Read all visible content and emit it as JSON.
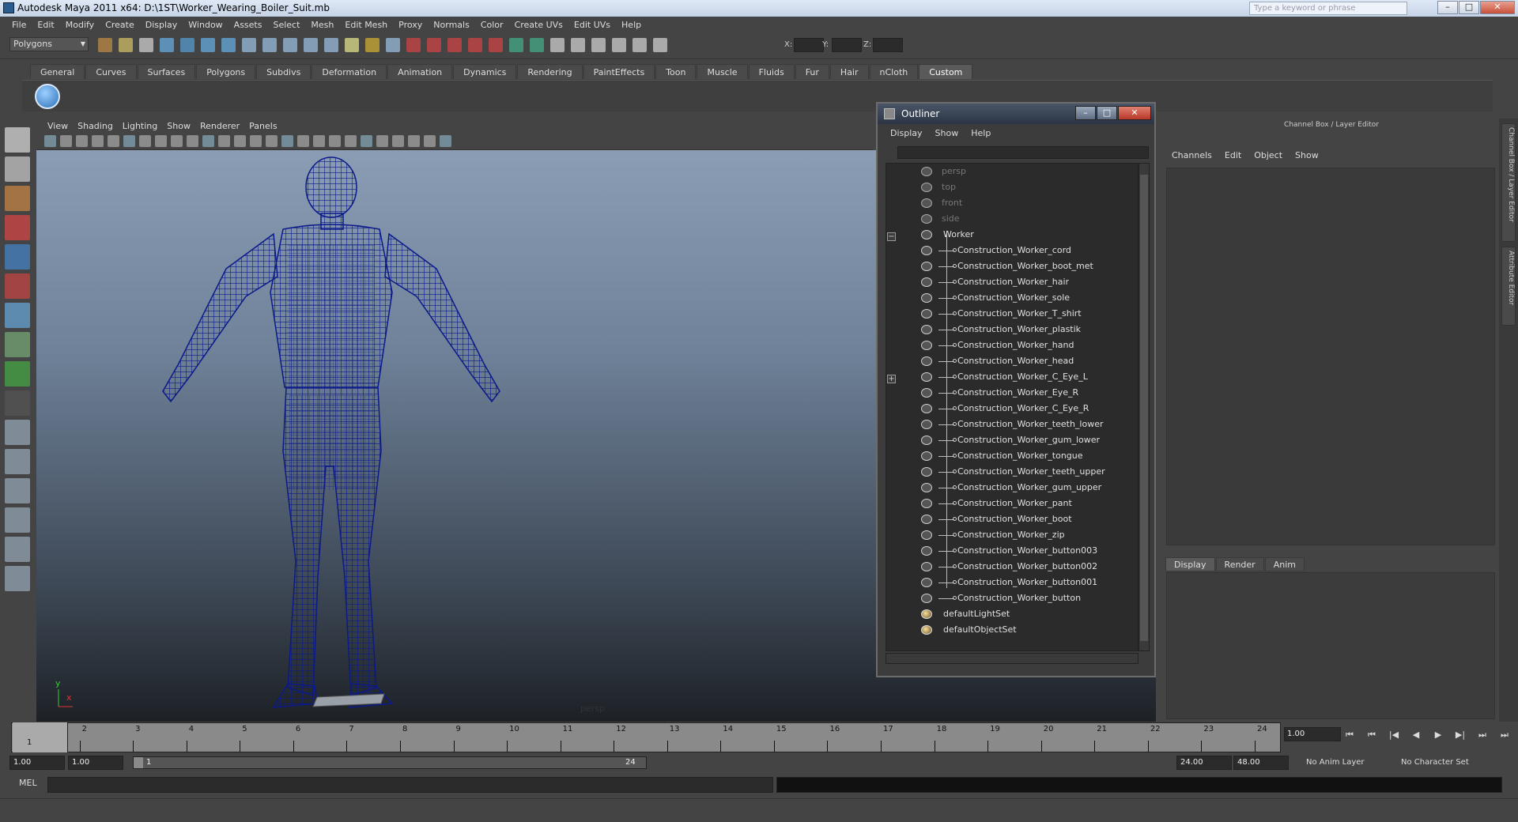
{
  "window": {
    "title": "Autodesk Maya 2011 x64: D:\\1ST\\Worker_Wearing_Boiler_Suit.mb",
    "search_placeholder": "Type a keyword or phrase",
    "min": "–",
    "max": "□",
    "close": "✕"
  },
  "menubar": [
    "File",
    "Edit",
    "Modify",
    "Create",
    "Display",
    "Window",
    "Assets",
    "Select",
    "Mesh",
    "Edit Mesh",
    "Proxy",
    "Normals",
    "Color",
    "Create UVs",
    "Edit UVs",
    "Help"
  ],
  "toolbar": {
    "mode": "Polygons",
    "x_label": "X:",
    "y_label": "Y:",
    "z_label": "Z:"
  },
  "shelf": {
    "tabs": [
      "General",
      "Curves",
      "Surfaces",
      "Polygons",
      "Subdivs",
      "Deformation",
      "Animation",
      "Dynamics",
      "Rendering",
      "PaintEffects",
      "Toon",
      "Muscle",
      "Fluids",
      "Fur",
      "Hair",
      "nCloth",
      "Custom"
    ],
    "active": "Custom"
  },
  "viewport": {
    "menu": [
      "View",
      "Shading",
      "Lighting",
      "Show",
      "Renderer",
      "Panels"
    ],
    "camera": "persp",
    "axis_y": "y",
    "axis_x": "x",
    "wire_color": "#0b1a8a"
  },
  "outliner": {
    "title": "Outliner",
    "menu": [
      "Display",
      "Show",
      "Help"
    ],
    "cameras": [
      "persp",
      "top",
      "front",
      "side"
    ],
    "group": "Worker",
    "children": [
      "Construction_Worker_cord",
      "Construction_Worker_boot_met",
      "Construction_Worker_hair",
      "Construction_Worker_sole",
      "Construction_Worker_T_shirt",
      "Construction_Worker_plastik",
      "Construction_Worker_hand",
      "Construction_Worker_head",
      "Construction_Worker_C_Eye_L",
      "Construction_Worker_Eye_R",
      "Construction_Worker_C_Eye_R",
      "Construction_Worker_teeth_lower",
      "Construction_Worker_gum_lower",
      "Construction_Worker_tongue",
      "Construction_Worker_teeth_upper",
      "Construction_Worker_gum_upper",
      "Construction_Worker_pant",
      "Construction_Worker_boot",
      "Construction_Worker_zip",
      "Construction_Worker_button003",
      "Construction_Worker_button002",
      "Construction_Worker_button001",
      "Construction_Worker_button"
    ],
    "sets": [
      "defaultLightSet",
      "defaultObjectSet"
    ],
    "collapse": "−",
    "expand": "+"
  },
  "channelbox": {
    "title": "Channel Box / Layer Editor",
    "menu": [
      "Channels",
      "Edit",
      "Object",
      "Show"
    ],
    "layer_tabs": [
      "Display",
      "Render",
      "Anim"
    ],
    "active_layer_tab": "Display"
  },
  "sidetabs": [
    "Channel Box / Layer Editor",
    "Attribute Editor"
  ],
  "timeline": {
    "ticks": [
      "1",
      "2",
      "3",
      "4",
      "5",
      "6",
      "7",
      "8",
      "9",
      "10",
      "11",
      "12",
      "13",
      "14",
      "15",
      "16",
      "17",
      "18",
      "19",
      "20",
      "21",
      "22",
      "23",
      "24"
    ],
    "current": "1",
    "current_field": "1.00"
  },
  "range": {
    "start": "1.00",
    "start2": "1.00",
    "slider_start": "1",
    "slider_end": "24",
    "end": "24.00",
    "end2": "48.00",
    "anim_layer": "No Anim Layer",
    "char_set": "No Character Set"
  },
  "cmd": {
    "label": "MEL"
  }
}
